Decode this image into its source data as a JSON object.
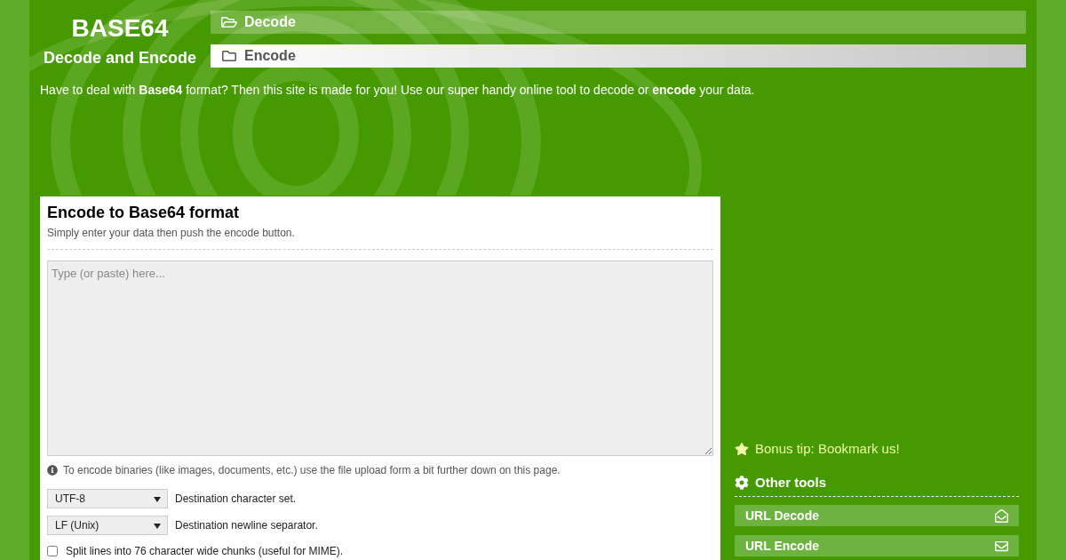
{
  "header": {
    "logo_title": "BASE64",
    "logo_subtitle": "Decode and Encode"
  },
  "nav": [
    {
      "label": "Decode",
      "selected": false
    },
    {
      "label": "Encode",
      "selected": true
    }
  ],
  "intro": "Have to deal with **Base64** format? Then this site is made for you! Use our super handy online tool to decode or **encode** your data.",
  "main": {
    "title": "Encode to Base64 format",
    "subtitle": "Simply enter your data then push the encode button.",
    "input": {
      "placeholder": "Type (or paste) here..."
    },
    "note": "To encode binaries (like images, documents, etc.) use the file upload form a bit further down on this page.",
    "options": [
      {
        "kind": "select",
        "value": "UTF-8",
        "label": "Destination character set."
      },
      {
        "kind": "select",
        "value": "LF (Unix)",
        "label": "Destination newline separator."
      },
      {
        "kind": "checkbox",
        "checked": false,
        "text": "Split lines into 76 character wide chunks (useful for MIME)."
      }
    ]
  },
  "sidebar": {
    "tip": "Bonus tip: Bookmark us!",
    "tools_heading": "Other tools",
    "tools": [
      {
        "kind": "decode",
        "label": "URL Decode"
      },
      {
        "kind": "encode",
        "label": "URL Encode"
      }
    ]
  }
}
